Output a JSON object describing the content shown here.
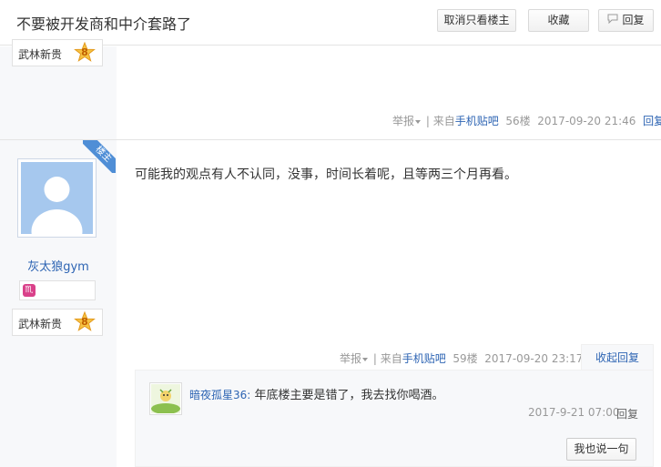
{
  "header": {
    "title": "不要被开发商和中介套路了",
    "only_op_label": "取消只看楼主",
    "favorite_label": "收藏",
    "reply_label": "回复"
  },
  "post_prev": {
    "rank_name": "武林新贵",
    "rank_level": "8",
    "report": "举报",
    "source_prefix": "| 来自",
    "source": "手机贴吧",
    "floor": "56楼",
    "time": "2017-09-20 21:46",
    "reply": "回复"
  },
  "post": {
    "op_badge": "楼主",
    "user": "灰太狼gym",
    "badge_glyph": "♏",
    "rank_name": "武林新贵",
    "rank_level": "8",
    "content": "可能我的观点有人不认同，没事，时间长着呢，且等两三个月再看。",
    "report": "举报",
    "source_prefix": "| 来自",
    "source": "手机贴吧",
    "floor": "59楼",
    "time": "2017-09-20 23:17",
    "collapse_reply": "收起回复"
  },
  "sub_reply": {
    "user": "暗夜孤星36:",
    "content": " 年底楼主要是错了，我去找你喝酒。",
    "time": "2017-9-21 07:00",
    "reply": "回复",
    "say_button": "我也说一句"
  },
  "colors": {
    "link": "#2d64b3",
    "avatar_bg": "#a6c8ee",
    "op_ribbon": "#4f8ed6",
    "sidebar": "#f7f8fa"
  }
}
